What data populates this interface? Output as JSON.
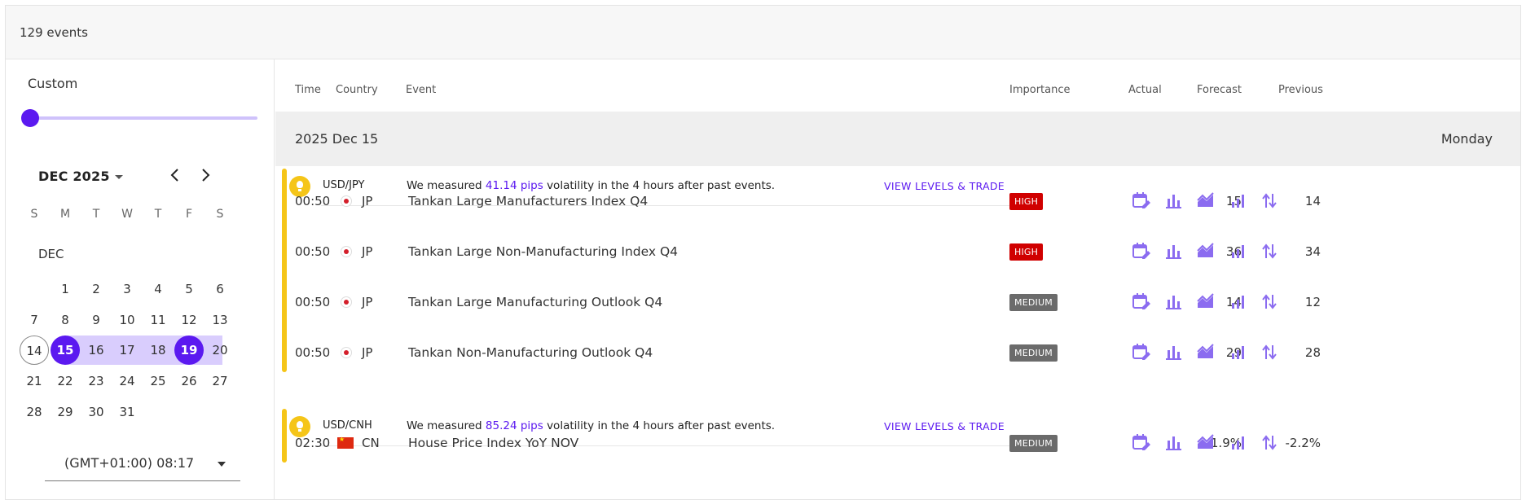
{
  "header": {
    "event_count": "129 events"
  },
  "sidebar": {
    "range_label": "Custom",
    "month_label": "DEC 2025",
    "prev_icon": "chevron-left-icon",
    "next_icon": "chevron-right-icon",
    "weekdays": [
      "S",
      "M",
      "T",
      "W",
      "T",
      "F",
      "S"
    ],
    "month_name": "DEC",
    "weeks": [
      [
        "",
        "1",
        "2",
        "3",
        "4",
        "5",
        "6"
      ],
      [
        "7",
        "8",
        "9",
        "10",
        "11",
        "12",
        "13"
      ],
      [
        "14",
        "15",
        "16",
        "17",
        "18",
        "19",
        "20"
      ],
      [
        "21",
        "22",
        "23",
        "24",
        "25",
        "26",
        "27"
      ],
      [
        "28",
        "29",
        "30",
        "31",
        "",
        "",
        ""
      ]
    ],
    "today": "14",
    "range_start": "15",
    "range_end": "19",
    "timezone": "(GMT+01:00) 08:17",
    "accent_color": "#5b19f0",
    "range_color": "#d9cdfd"
  },
  "table": {
    "columns": {
      "time": "Time",
      "country": "Country",
      "event": "Event",
      "importance": "Importance",
      "actual": "Actual",
      "forecast": "Forecast",
      "previous": "Previous"
    },
    "day_header": {
      "date": "2025 Dec 15",
      "weekday": "Monday"
    },
    "groups": [
      {
        "pair": "USD/JPY",
        "text_before": "We measured ",
        "pips": "41.14 pips",
        "text_after": " volatility in the 4 hours after past events.",
        "link": "VIEW LEVELS & TRADE",
        "rows": [
          {
            "time": "00:50",
            "country": "JP",
            "event": "Tankan Large Manufacturers Index Q4",
            "importance": "HIGH",
            "actual": "",
            "forecast": "15",
            "previous": "14"
          },
          {
            "time": "00:50",
            "country": "JP",
            "event": "Tankan Large Non-Manufacturing Index Q4",
            "importance": "HIGH",
            "actual": "",
            "forecast": "36",
            "previous": "34"
          },
          {
            "time": "00:50",
            "country": "JP",
            "event": "Tankan Large Manufacturing Outlook Q4",
            "importance": "MEDIUM",
            "actual": "",
            "forecast": "14",
            "previous": "12"
          },
          {
            "time": "00:50",
            "country": "JP",
            "event": "Tankan Non-Manufacturing Outlook Q4",
            "importance": "MEDIUM",
            "actual": "",
            "forecast": "29",
            "previous": "28"
          }
        ]
      },
      {
        "pair": "USD/CNH",
        "text_before": "We measured ",
        "pips": "85.24 pips",
        "text_after": " volatility in the 4 hours after past events.",
        "link": "VIEW LEVELS & TRADE",
        "rows": [
          {
            "time": "02:30",
            "country": "CN",
            "event": "House Price Index YoY NOV",
            "importance": "MEDIUM",
            "actual": "",
            "forecast": "-1.9%",
            "previous": "-2.2%"
          }
        ]
      }
    ],
    "row_icons": [
      "calendar-edit-icon",
      "bar-chart-icon",
      "area-chart-icon",
      "signal-chart-icon",
      "sort-arrows-icon"
    ],
    "colors": {
      "high": "#d00000",
      "medium": "#6b6b6b",
      "link": "#5b19f0",
      "group_bar": "#f5c518",
      "icon": "#8b6cf0"
    }
  }
}
